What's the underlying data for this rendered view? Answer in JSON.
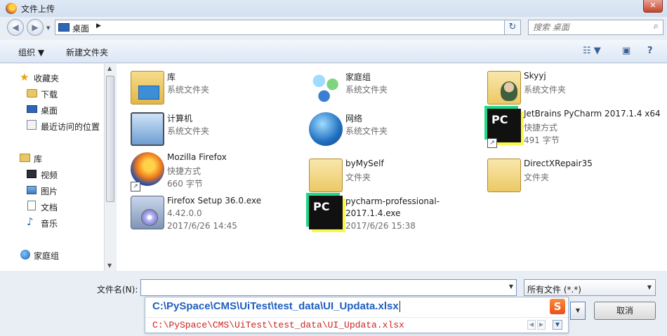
{
  "window": {
    "title": "文件上传",
    "close_glyph": "✕"
  },
  "nav": {
    "back_glyph": "◀",
    "forward_glyph": "▶",
    "dropdown_glyph": "▼",
    "address": {
      "crumb": "桌面",
      "arrow": "▶",
      "drop": "▼"
    },
    "refresh_glyph": "↻",
    "search_placeholder": "搜索 桌面",
    "search_glyph": "⌕"
  },
  "toolbar": {
    "organize": "组织 ▼",
    "new_folder": "新建文件夹",
    "view_glyph": "☷ ▼",
    "pane_glyph": "▣",
    "help_glyph": "?"
  },
  "sidebar": {
    "items": [
      {
        "label": "收藏夹",
        "icon": "star-icon"
      },
      {
        "label": "下载",
        "icon": "download-folder-icon"
      },
      {
        "label": "桌面",
        "icon": "desktop-icon"
      },
      {
        "label": "最近访问的位置",
        "icon": "recent-places-icon"
      },
      {
        "label": "库",
        "icon": "library-icon"
      },
      {
        "label": "视频",
        "icon": "video-icon"
      },
      {
        "label": "图片",
        "icon": "pictures-icon"
      },
      {
        "label": "文档",
        "icon": "documents-icon"
      },
      {
        "label": "音乐",
        "icon": "music-icon"
      },
      {
        "label": "家庭组",
        "icon": "homegroup-icon"
      }
    ],
    "scroll_up": "▲",
    "scroll_down": "▼"
  },
  "files": [
    {
      "name": "库",
      "line1": "系统文件夹",
      "line2": "",
      "icon": "library-folder-icon"
    },
    {
      "name": "家庭组",
      "line1": "系统文件夹",
      "line2": "",
      "icon": "homegroup-icon"
    },
    {
      "name": "Skyyj",
      "line1": "系统文件夹",
      "line2": "",
      "icon": "user-folder-icon"
    },
    {
      "name": "计算机",
      "line1": "系统文件夹",
      "line2": "",
      "icon": "computer-icon"
    },
    {
      "name": "网络",
      "line1": "系统文件夹",
      "line2": "",
      "icon": "network-globe-icon"
    },
    {
      "name": "JetBrains PyCharm 2017.1.4 x64",
      "line1": "快捷方式",
      "line2": "491 字节",
      "icon": "pycharm-icon"
    },
    {
      "name": "Mozilla Firefox",
      "line1": "快捷方式",
      "line2": "660 字节",
      "icon": "firefox-icon"
    },
    {
      "name": "byMySelf",
      "line1": "文件夹",
      "line2": "",
      "icon": "folder-icon"
    },
    {
      "name": "DirectXRepair35",
      "line1": "文件夹",
      "line2": "",
      "icon": "folder-icon"
    },
    {
      "name": "Firefox Setup 36.0.exe",
      "line1": "4.42.0.0",
      "line2": "2017/6/26 14:45",
      "icon": "setup-installer-icon"
    },
    {
      "name": "pycharm-professional-2017.1.4.exe",
      "line1": "2017/6/26 15:38",
      "line2": "",
      "icon": "pycharm-icon"
    }
  ],
  "pycharm_badge": "PC",
  "shortcut_glyph": "↗",
  "bottom": {
    "filename_label": "文件名(N):",
    "filename_value": "",
    "drop_glyph": "▼",
    "filetype": "所有文件 (*.*)",
    "cancel": "取消"
  },
  "ime": {
    "composition": "C:\\PySpace\\CMS\\UiTest\\test_data\\UI_Updata.xlsx",
    "candidate": "C:\\PySpace\\CMS\\UiTest\\test_data\\UI_Updata.xlsx",
    "logo": "S",
    "prev": "◀",
    "next": "▶",
    "more": "▼"
  }
}
